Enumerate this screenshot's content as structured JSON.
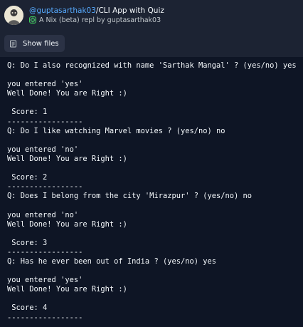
{
  "header": {
    "owner": "@guptasarthak03",
    "separator": "/",
    "repl_name": "CLI App with Quiz",
    "subtitle": "A Nix (beta) repl by guptasarthak03"
  },
  "toolbar": {
    "show_files_label": "Show files"
  },
  "console": {
    "lines": [
      "Q: Do I also recognized with name 'Sarthak Mangal' ? (yes/no) yes",
      "",
      "you entered 'yes'",
      "Well Done! You are Right :)",
      "",
      " Score: 1",
      "-----------------",
      "Q: Do I like watching Marvel movies ? (yes/no) no",
      "",
      "you entered 'no'",
      "Well Done! You are Right :)",
      "",
      " Score: 2",
      "-----------------",
      "Q: Does I belong from the city 'Mirazpur' ? (yes/no) no",
      "",
      "you entered 'no'",
      "Well Done! You are Right :)",
      "",
      " Score: 3",
      "-----------------",
      "Q: Has he ever been out of India ? (yes/no) yes",
      "",
      "you entered 'yes'",
      "Well Done! You are Right :)",
      "",
      " Score: 4",
      "-----------------"
    ]
  },
  "colors": {
    "header_bg": "#1c2333",
    "console_bg": "#0e1525",
    "link_blue": "#57abff",
    "text": "#f5f9fc"
  },
  "icons": {
    "avatar": "user-avatar",
    "nix": "nix-icon",
    "files": "files-icon"
  }
}
